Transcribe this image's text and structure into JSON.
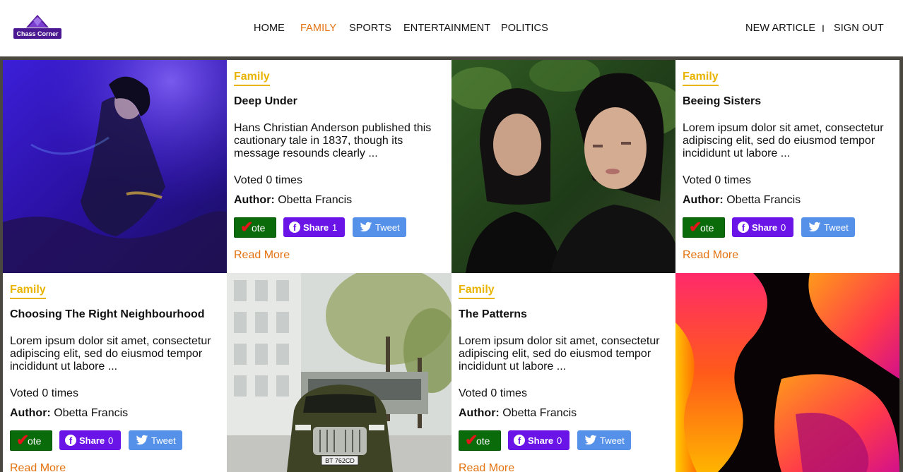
{
  "brand": {
    "logo_text": "Chass Corner"
  },
  "nav": {
    "items": [
      "HOME",
      "FAMILY",
      "SPORTS",
      "ENTERTAINMENT",
      "POLITICS"
    ],
    "active": "FAMILY",
    "new_article": "NEW ARTICLE",
    "separator": "I",
    "sign_out": "SIGN OUT"
  },
  "colors": {
    "accent": "#e3720f",
    "category": "#e8b400",
    "vote": "#0a6b0a",
    "share": "#6b14e8",
    "tweet": "#5591e8"
  },
  "labels": {
    "author_prefix": "Author:",
    "vote": "ote",
    "share": "Share",
    "tweet": "Tweet",
    "read_more": "Read More"
  },
  "articles": [
    {
      "category": "Family",
      "title": "Deep Under",
      "excerpt": "Hans Christian Anderson published this cautionary tale in 1837, though its message resounds clearly ...",
      "voted": "Voted 0 times",
      "author": "Obetta Francis",
      "share_count": "1",
      "image": "underwater-woman-photo"
    },
    {
      "category": "Family",
      "title": "Beeing Sisters",
      "excerpt": "Lorem ipsum dolor sit amet, consectetur adipiscing elit, sed do eiusmod tempor incididunt ut labore ...",
      "voted": "Voted 0 times",
      "author": "Obetta Francis",
      "share_count": "0",
      "image": "two-women-photo"
    },
    {
      "category": "Family",
      "title": "Choosing The Right Neighbourhood",
      "excerpt": "Lorem ipsum dolor sit amet, consectetur adipiscing elit, sed do eiusmod tempor incididunt ut labore ...",
      "voted": "Voted 0 times",
      "author": "Obetta Francis",
      "share_count": "0",
      "image": "car-street-photo",
      "plate": "BT 762CD"
    },
    {
      "category": "Family",
      "title": "The Patterns",
      "excerpt": "Lorem ipsum dolor sit amet, consectetur adipiscing elit, sed do eiusmod tempor incididunt ut labore ...",
      "voted": "Voted 0 times",
      "author": "Obetta Francis",
      "share_count": "0",
      "image": "abstract-gradient-image"
    }
  ]
}
